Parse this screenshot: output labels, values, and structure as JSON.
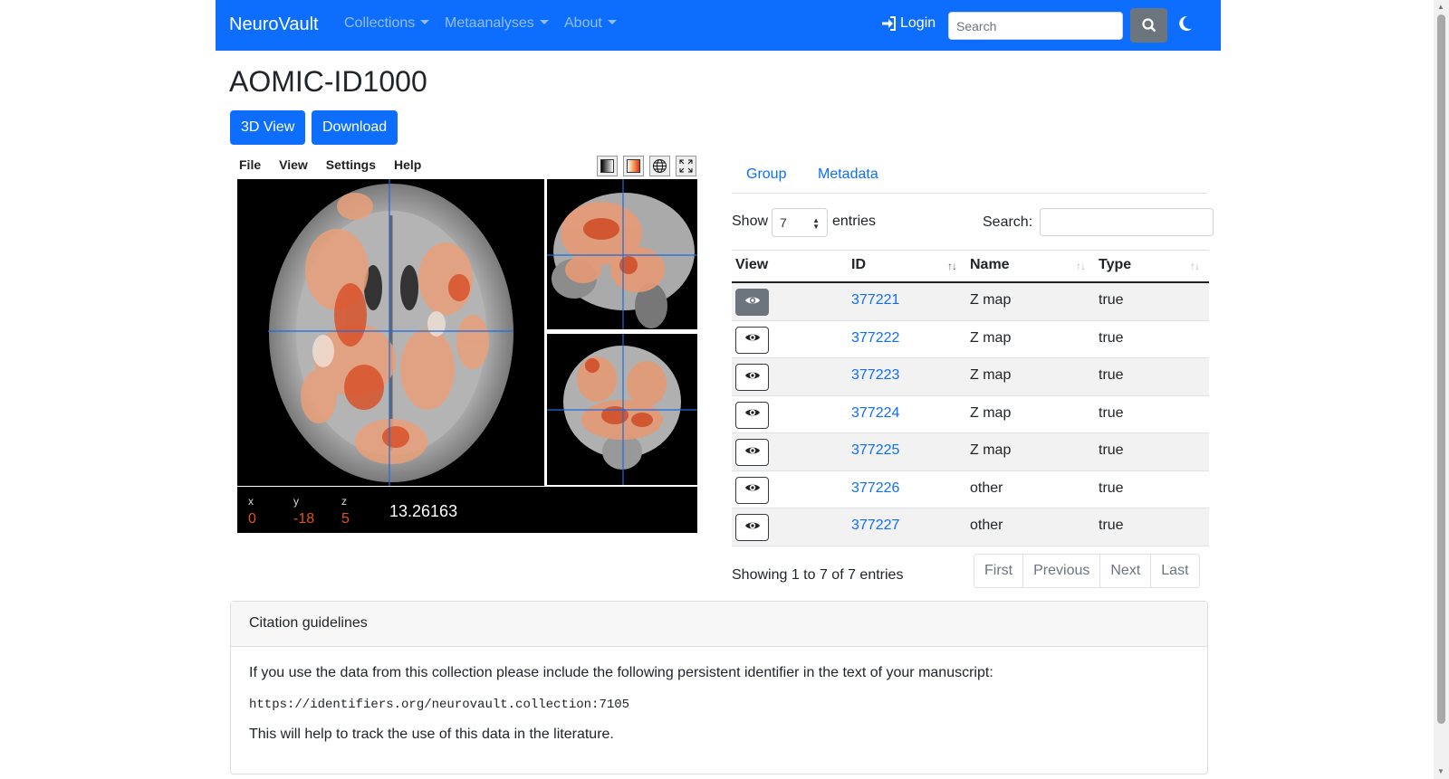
{
  "navbar": {
    "brand": "NeuroVault",
    "items": [
      "Collections",
      "Metaanalyses",
      "About"
    ],
    "login": "Login",
    "search_placeholder": "Search"
  },
  "page": {
    "title": "AOMIC-ID1000",
    "buttons": {
      "view3d": "3D View",
      "download": "Download"
    }
  },
  "viewer": {
    "menu": [
      "File",
      "View",
      "Settings",
      "Help"
    ],
    "coords": {
      "x_label": "x",
      "y_label": "y",
      "z_label": "z",
      "x": "0",
      "y": "-18",
      "z": "5",
      "intensity": "13.26163"
    }
  },
  "tabs": [
    "Group",
    "Metadata"
  ],
  "table": {
    "show_label": "Show",
    "entries_value": "7",
    "entries_label": "entries",
    "search_label": "Search:",
    "columns": [
      "View",
      "ID",
      "Name",
      "Type"
    ],
    "rows": [
      {
        "id": "377221",
        "name": "Z map",
        "type": "true"
      },
      {
        "id": "377222",
        "name": "Z map",
        "type": "true"
      },
      {
        "id": "377223",
        "name": "Z map",
        "type": "true"
      },
      {
        "id": "377224",
        "name": "Z map",
        "type": "true"
      },
      {
        "id": "377225",
        "name": "Z map",
        "type": "true"
      },
      {
        "id": "377226",
        "name": "other",
        "type": "true"
      },
      {
        "id": "377227",
        "name": "other",
        "type": "true"
      }
    ],
    "info": "Showing 1 to 7 of 7 entries",
    "pager": [
      "First",
      "Previous",
      "Next",
      "Last"
    ]
  },
  "citation": {
    "header": "Citation guidelines",
    "intro": "If you use the data from this collection please include the following persistent identifier in the text of your manuscript:",
    "identifier": "https://identifiers.org/neurovault.collection:7105",
    "outro": "This will help to track the use of this data in the literature."
  }
}
